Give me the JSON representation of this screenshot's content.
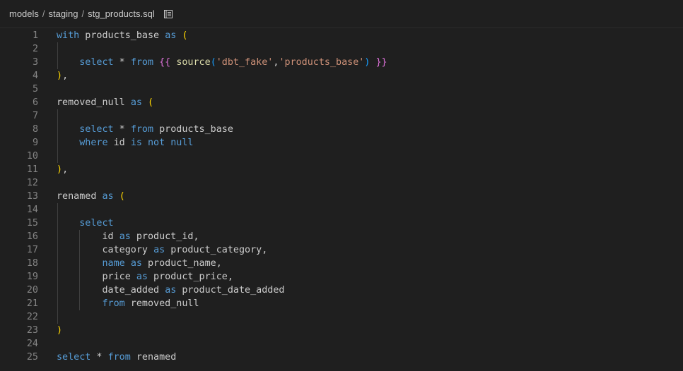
{
  "breadcrumb": {
    "segments": [
      "models",
      "staging",
      "stg_products.sql"
    ],
    "separator": "/",
    "icon": "outline-list-icon"
  },
  "editor": {
    "language": "sql",
    "lines": [
      {
        "n": "1",
        "tokens": [
          {
            "t": "with",
            "c": "kw"
          },
          {
            "t": " products_base ",
            "c": "id"
          },
          {
            "t": "as",
            "c": "kw"
          },
          {
            "t": " ",
            "c": "id"
          },
          {
            "t": "(",
            "c": "p1"
          }
        ]
      },
      {
        "n": "2",
        "tokens": []
      },
      {
        "n": "3",
        "tokens": [
          {
            "t": "    ",
            "c": "id"
          },
          {
            "t": "select",
            "c": "kw"
          },
          {
            "t": " * ",
            "c": "id"
          },
          {
            "t": "from",
            "c": "kw"
          },
          {
            "t": " ",
            "c": "id"
          },
          {
            "t": "{{",
            "c": "p2"
          },
          {
            "t": " ",
            "c": "id"
          },
          {
            "t": "source",
            "c": "fn"
          },
          {
            "t": "(",
            "c": "p3"
          },
          {
            "t": "'dbt_fake'",
            "c": "str"
          },
          {
            "t": ",",
            "c": "id"
          },
          {
            "t": "'products_base'",
            "c": "str"
          },
          {
            "t": ")",
            "c": "p3"
          },
          {
            "t": " ",
            "c": "id"
          },
          {
            "t": "}}",
            "c": "p2"
          }
        ]
      },
      {
        "n": "4",
        "tokens": [
          {
            "t": ")",
            "c": "p1"
          },
          {
            "t": ",",
            "c": "id"
          }
        ]
      },
      {
        "n": "5",
        "tokens": []
      },
      {
        "n": "6",
        "tokens": [
          {
            "t": "removed_null ",
            "c": "id"
          },
          {
            "t": "as",
            "c": "kw"
          },
          {
            "t": " ",
            "c": "id"
          },
          {
            "t": "(",
            "c": "p1"
          }
        ]
      },
      {
        "n": "7",
        "tokens": []
      },
      {
        "n": "8",
        "tokens": [
          {
            "t": "    ",
            "c": "id"
          },
          {
            "t": "select",
            "c": "kw"
          },
          {
            "t": " * ",
            "c": "id"
          },
          {
            "t": "from",
            "c": "kw"
          },
          {
            "t": " products_base",
            "c": "id"
          }
        ]
      },
      {
        "n": "9",
        "tokens": [
          {
            "t": "    ",
            "c": "id"
          },
          {
            "t": "where",
            "c": "kw"
          },
          {
            "t": " id ",
            "c": "id"
          },
          {
            "t": "is",
            "c": "kw"
          },
          {
            "t": " ",
            "c": "id"
          },
          {
            "t": "not",
            "c": "kw"
          },
          {
            "t": " ",
            "c": "id"
          },
          {
            "t": "null",
            "c": "kw"
          }
        ]
      },
      {
        "n": "10",
        "tokens": []
      },
      {
        "n": "11",
        "tokens": [
          {
            "t": ")",
            "c": "p1"
          },
          {
            "t": ",",
            "c": "id"
          }
        ]
      },
      {
        "n": "12",
        "tokens": []
      },
      {
        "n": "13",
        "tokens": [
          {
            "t": "renamed ",
            "c": "id"
          },
          {
            "t": "as",
            "c": "kw"
          },
          {
            "t": " ",
            "c": "id"
          },
          {
            "t": "(",
            "c": "p1"
          }
        ]
      },
      {
        "n": "14",
        "tokens": []
      },
      {
        "n": "15",
        "tokens": [
          {
            "t": "    ",
            "c": "id"
          },
          {
            "t": "select",
            "c": "kw"
          }
        ]
      },
      {
        "n": "16",
        "tokens": [
          {
            "t": "        id ",
            "c": "id"
          },
          {
            "t": "as",
            "c": "kw"
          },
          {
            "t": " product_id,",
            "c": "id"
          }
        ]
      },
      {
        "n": "17",
        "tokens": [
          {
            "t": "        category ",
            "c": "id"
          },
          {
            "t": "as",
            "c": "kw"
          },
          {
            "t": " product_category,",
            "c": "id"
          }
        ]
      },
      {
        "n": "18",
        "tokens": [
          {
            "t": "        ",
            "c": "id"
          },
          {
            "t": "name",
            "c": "kw"
          },
          {
            "t": " ",
            "c": "id"
          },
          {
            "t": "as",
            "c": "kw"
          },
          {
            "t": " product_name,",
            "c": "id"
          }
        ]
      },
      {
        "n": "19",
        "tokens": [
          {
            "t": "        price ",
            "c": "id"
          },
          {
            "t": "as",
            "c": "kw"
          },
          {
            "t": " product_price,",
            "c": "id"
          }
        ]
      },
      {
        "n": "20",
        "tokens": [
          {
            "t": "        date_added ",
            "c": "id"
          },
          {
            "t": "as",
            "c": "kw"
          },
          {
            "t": " product_date_added",
            "c": "id"
          }
        ]
      },
      {
        "n": "21",
        "tokens": [
          {
            "t": "        ",
            "c": "id"
          },
          {
            "t": "from",
            "c": "kw"
          },
          {
            "t": " removed_null",
            "c": "id"
          }
        ]
      },
      {
        "n": "22",
        "tokens": []
      },
      {
        "n": "23",
        "tokens": [
          {
            "t": ")",
            "c": "p1"
          }
        ]
      },
      {
        "n": "24",
        "tokens": []
      },
      {
        "n": "25",
        "tokens": [
          {
            "t": "select",
            "c": "kw"
          },
          {
            "t": " * ",
            "c": "id"
          },
          {
            "t": "from",
            "c": "kw"
          },
          {
            "t": " renamed",
            "c": "id"
          }
        ]
      }
    ]
  },
  "colors": {
    "keyword": "#569cd6",
    "string": "#ce9178",
    "function": "#dcdcaa",
    "bracket_level1": "#ffd700",
    "bracket_level2": "#da70d6",
    "bracket_level3": "#179fff"
  }
}
